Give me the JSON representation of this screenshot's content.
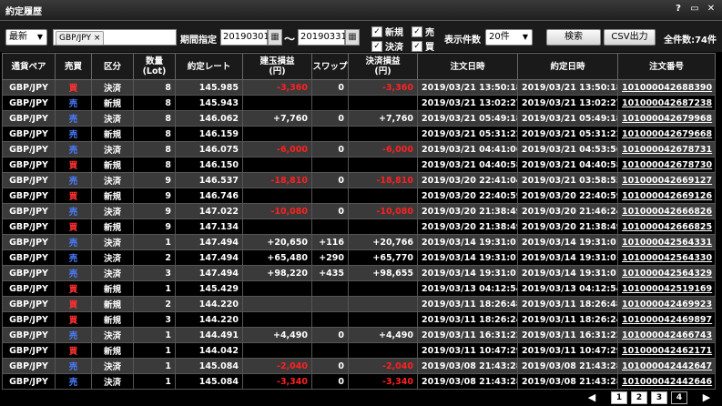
{
  "window": {
    "title": "約定履歴",
    "help": "?",
    "restore": "▭",
    "close": "✕"
  },
  "toolbar": {
    "sort_value": "最新",
    "pair_chip": "GBP/JPY",
    "period_label": "期間指定",
    "date_from": "20190301",
    "date_to": "20190331",
    "tilde": "〜",
    "chk_new": "新規",
    "chk_sell": "売",
    "chk_settle": "決済",
    "chk_buy": "買",
    "display_count_label": "表示件数",
    "display_count_value": "20件",
    "search_label": "検索",
    "csv_label": "CSV出力",
    "total_label": "全件数:74件"
  },
  "columns": [
    "通貨ペア",
    "売買",
    "区分",
    "数量\n(Lot)",
    "約定レート",
    "建玉損益\n(円)",
    "スワップ",
    "決済損益\n(円)",
    "注文日時",
    "約定日時",
    "注文番号"
  ],
  "rows": [
    {
      "pair": "GBP/JPY",
      "side": "買",
      "type": "決済",
      "qty": "8",
      "rate": "145.985",
      "pos_pl": "-3,360",
      "swap": "0",
      "settle_pl": "-3,360",
      "order_dt": "2019/03/21 13:50:18",
      "exec_dt": "2019/03/21 13:50:18",
      "order_no": "101000042688390"
    },
    {
      "pair": "GBP/JPY",
      "side": "売",
      "type": "新規",
      "qty": "8",
      "rate": "145.943",
      "pos_pl": "",
      "swap": "",
      "settle_pl": "",
      "order_dt": "2019/03/21 13:02:27",
      "exec_dt": "2019/03/21 13:02:27",
      "order_no": "101000042687238"
    },
    {
      "pair": "GBP/JPY",
      "side": "売",
      "type": "決済",
      "qty": "8",
      "rate": "146.062",
      "pos_pl": "+7,760",
      "swap": "0",
      "settle_pl": "+7,760",
      "order_dt": "2019/03/21 05:49:18",
      "exec_dt": "2019/03/21 05:49:18",
      "order_no": "101000042679968"
    },
    {
      "pair": "GBP/JPY",
      "side": "売",
      "type": "新規",
      "qty": "8",
      "rate": "146.159",
      "pos_pl": "",
      "swap": "",
      "settle_pl": "",
      "order_dt": "2019/03/21 05:31:22",
      "exec_dt": "2019/03/21 05:31:22",
      "order_no": "101000042679668"
    },
    {
      "pair": "GBP/JPY",
      "side": "売",
      "type": "決済",
      "qty": "8",
      "rate": "146.075",
      "pos_pl": "-6,000",
      "swap": "0",
      "settle_pl": "-6,000",
      "order_dt": "2019/03/21 04:41:06",
      "exec_dt": "2019/03/21 04:53:56",
      "order_no": "101000042678731"
    },
    {
      "pair": "GBP/JPY",
      "side": "買",
      "type": "新規",
      "qty": "8",
      "rate": "146.150",
      "pos_pl": "",
      "swap": "",
      "settle_pl": "",
      "order_dt": "2019/03/21 04:40:58",
      "exec_dt": "2019/03/21 04:40:58",
      "order_no": "101000042678730"
    },
    {
      "pair": "GBP/JPY",
      "side": "売",
      "type": "決済",
      "qty": "9",
      "rate": "146.537",
      "pos_pl": "-18,810",
      "swap": "0",
      "settle_pl": "-18,810",
      "order_dt": "2019/03/20 22:41:04",
      "exec_dt": "2019/03/21 03:58:55",
      "order_no": "101000042669127"
    },
    {
      "pair": "GBP/JPY",
      "side": "買",
      "type": "新規",
      "qty": "9",
      "rate": "146.746",
      "pos_pl": "",
      "swap": "",
      "settle_pl": "",
      "order_dt": "2019/03/20 22:40:59",
      "exec_dt": "2019/03/20 22:40:59",
      "order_no": "101000042669126"
    },
    {
      "pair": "GBP/JPY",
      "side": "売",
      "type": "決済",
      "qty": "9",
      "rate": "147.022",
      "pos_pl": "-10,080",
      "swap": "0",
      "settle_pl": "-10,080",
      "order_dt": "2019/03/20 21:38:49",
      "exec_dt": "2019/03/20 21:46:24",
      "order_no": "101000042666826"
    },
    {
      "pair": "GBP/JPY",
      "side": "買",
      "type": "新規",
      "qty": "9",
      "rate": "147.134",
      "pos_pl": "",
      "swap": "",
      "settle_pl": "",
      "order_dt": "2019/03/20 21:38:49",
      "exec_dt": "2019/03/20 21:38:49",
      "order_no": "101000042666825"
    },
    {
      "pair": "GBP/JPY",
      "side": "売",
      "type": "決済",
      "qty": "1",
      "rate": "147.494",
      "pos_pl": "+20,650",
      "swap": "+116",
      "settle_pl": "+20,766",
      "order_dt": "2019/03/14 19:31:01",
      "exec_dt": "2019/03/14 19:31:01",
      "order_no": "101000042564331"
    },
    {
      "pair": "GBP/JPY",
      "side": "売",
      "type": "決済",
      "qty": "2",
      "rate": "147.494",
      "pos_pl": "+65,480",
      "swap": "+290",
      "settle_pl": "+65,770",
      "order_dt": "2019/03/14 19:31:01",
      "exec_dt": "2019/03/14 19:31:01",
      "order_no": "101000042564330"
    },
    {
      "pair": "GBP/JPY",
      "side": "売",
      "type": "決済",
      "qty": "3",
      "rate": "147.494",
      "pos_pl": "+98,220",
      "swap": "+435",
      "settle_pl": "+98,655",
      "order_dt": "2019/03/14 19:31:01",
      "exec_dt": "2019/03/14 19:31:01",
      "order_no": "101000042564329"
    },
    {
      "pair": "GBP/JPY",
      "side": "買",
      "type": "新規",
      "qty": "1",
      "rate": "145.429",
      "pos_pl": "",
      "swap": "",
      "settle_pl": "",
      "order_dt": "2019/03/13 04:12:54",
      "exec_dt": "2019/03/13 04:12:54",
      "order_no": "101000042519169"
    },
    {
      "pair": "GBP/JPY",
      "side": "買",
      "type": "新規",
      "qty": "2",
      "rate": "144.220",
      "pos_pl": "",
      "swap": "",
      "settle_pl": "",
      "order_dt": "2019/03/11 18:26:48",
      "exec_dt": "2019/03/11 18:26:48",
      "order_no": "101000042469923"
    },
    {
      "pair": "GBP/JPY",
      "side": "買",
      "type": "新規",
      "qty": "3",
      "rate": "144.220",
      "pos_pl": "",
      "swap": "",
      "settle_pl": "",
      "order_dt": "2019/03/11 18:26:24",
      "exec_dt": "2019/03/11 18:26:24",
      "order_no": "101000042469897"
    },
    {
      "pair": "GBP/JPY",
      "side": "売",
      "type": "決済",
      "qty": "1",
      "rate": "144.491",
      "pos_pl": "+4,490",
      "swap": "0",
      "settle_pl": "+4,490",
      "order_dt": "2019/03/11 16:31:22",
      "exec_dt": "2019/03/11 16:31:22",
      "order_no": "101000042466743"
    },
    {
      "pair": "GBP/JPY",
      "side": "買",
      "type": "新規",
      "qty": "1",
      "rate": "144.042",
      "pos_pl": "",
      "swap": "",
      "settle_pl": "",
      "order_dt": "2019/03/11 10:47:29",
      "exec_dt": "2019/03/11 10:47:29",
      "order_no": "101000042462171"
    },
    {
      "pair": "GBP/JPY",
      "side": "売",
      "type": "決済",
      "qty": "1",
      "rate": "145.084",
      "pos_pl": "-2,040",
      "swap": "0",
      "settle_pl": "-2,040",
      "order_dt": "2019/03/08 21:43:28",
      "exec_dt": "2019/03/08 21:43:28",
      "order_no": "101000042442647"
    },
    {
      "pair": "GBP/JPY",
      "side": "売",
      "type": "決済",
      "qty": "1",
      "rate": "145.084",
      "pos_pl": "-3,340",
      "swap": "0",
      "settle_pl": "-3,340",
      "order_dt": "2019/03/08 21:43:28",
      "exec_dt": "2019/03/08 21:43:28",
      "order_no": "101000042442646"
    }
  ],
  "pager": {
    "prev": "◀",
    "next": "▶",
    "pages": [
      "1",
      "2",
      "3",
      "4"
    ],
    "current": "4"
  },
  "colors": {
    "buy": "#ff3030",
    "sell": "#4a7dff",
    "negative": "#ff2020",
    "row_odd": "#3a3a3a",
    "row_even": "#000000"
  }
}
